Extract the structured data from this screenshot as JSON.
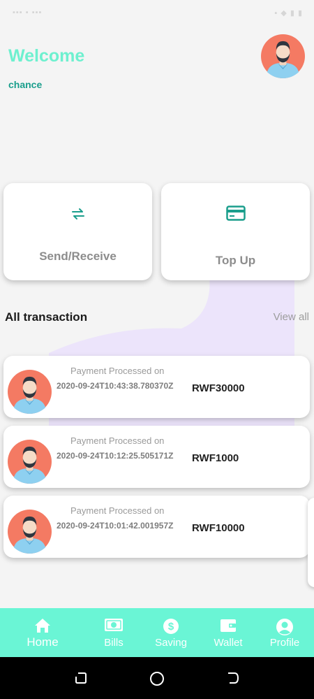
{
  "header": {
    "welcome": "Welcome",
    "username": "chance"
  },
  "actions": {
    "send_receive": "Send/Receive",
    "top_up": "Top Up"
  },
  "transactions_section": {
    "title": "All transaction",
    "view_all": "View all"
  },
  "transactions": [
    {
      "title": "Payment Processed on",
      "date": "2020-09-24T10:43:38.780370Z",
      "amount": "RWF30000"
    },
    {
      "title": "Payment Processed on",
      "date": "2020-09-24T10:12:25.505171Z",
      "amount": "RWF1000"
    },
    {
      "title": "Payment Processed on",
      "date": "2020-09-24T10:01:42.001957Z",
      "amount": "RWF10000"
    }
  ],
  "nav": [
    {
      "label": "Home",
      "icon": "home-icon",
      "active": true
    },
    {
      "label": "Bills",
      "icon": "bills-icon",
      "active": false
    },
    {
      "label": "Saving",
      "icon": "dollar-icon",
      "active": false
    },
    {
      "label": "Wallet",
      "icon": "wallet-icon",
      "active": false
    },
    {
      "label": "Profile",
      "icon": "profile-icon",
      "active": false
    }
  ],
  "colors": {
    "accent": "#6af5d5",
    "welcome": "#6ef0cf",
    "teal": "#1a9e8c",
    "blob": "#ece4fb",
    "avatar_bg": "#f47a63"
  }
}
